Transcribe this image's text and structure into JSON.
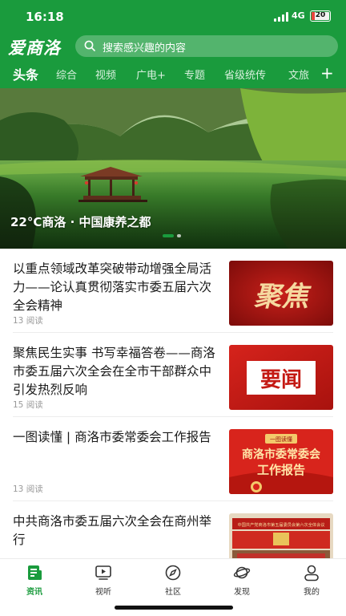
{
  "status_bar": {
    "time": "16:18",
    "network": "4G",
    "battery_text": "20",
    "battery_level": 0.2,
    "battery_color": "#e8433e"
  },
  "header": {
    "logo": "爱商洛",
    "search_placeholder": "搜索感兴趣的内容",
    "tabs": [
      {
        "label": "头条",
        "active": true
      },
      {
        "label": "综合"
      },
      {
        "label": "视频"
      },
      {
        "label": "广电+"
      },
      {
        "label": "专题"
      },
      {
        "label": "省级统传"
      },
      {
        "label": "文旅"
      }
    ],
    "add_icon": "plus-icon",
    "brand_color": "#1a9b3d"
  },
  "banner": {
    "caption": "22°C商洛 · 中国康养之都",
    "page_index": 0,
    "page_count": 2
  },
  "news": [
    {
      "title": "以重点领域改革突破带动增强全局活力——论认真贯彻落实市委五届六次全会精神",
      "meta": "13 阅读",
      "thumb_text": "聚焦"
    },
    {
      "title": "聚焦民生实事 书写幸福答卷——商洛市委五届六次全会在全市干部群众中引发热烈反响",
      "meta": "15 阅读",
      "thumb_text": "要闻"
    },
    {
      "title": "一图读懂 | 商洛市委常委会工作报告",
      "meta": "13 阅读",
      "thumb_badge": "一图读懂",
      "thumb_line1": "商洛市委常委会",
      "thumb_line2": "工作报告"
    },
    {
      "title": "中共商洛市委五届六次全会在商州举行",
      "meta": "",
      "thumb_banner": "中国共产党商洛市第五届委员会第六次全体会议"
    }
  ],
  "bottom_nav": [
    {
      "label": "资讯",
      "icon": "news-icon",
      "active": true
    },
    {
      "label": "视听",
      "icon": "video-icon"
    },
    {
      "label": "社区",
      "icon": "compass-icon"
    },
    {
      "label": "发现",
      "icon": "planet-icon"
    },
    {
      "label": "我的",
      "icon": "user-icon"
    }
  ]
}
